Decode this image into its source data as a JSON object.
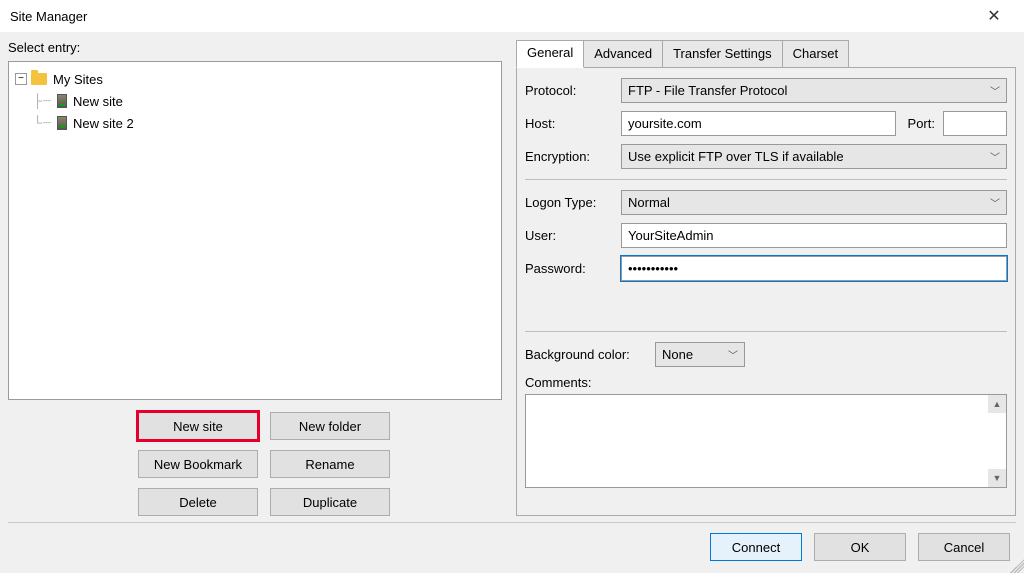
{
  "window": {
    "title": "Site Manager"
  },
  "left": {
    "select_label": "Select entry:",
    "tree": {
      "root": "My Sites",
      "children": [
        {
          "label": "New site"
        },
        {
          "label": "New site 2"
        }
      ]
    },
    "buttons": {
      "new_site": "New site",
      "new_folder": "New folder",
      "new_bookmark": "New Bookmark",
      "rename": "Rename",
      "delete": "Delete",
      "duplicate": "Duplicate"
    }
  },
  "tabs": {
    "general": "General",
    "advanced": "Advanced",
    "transfer": "Transfer Settings",
    "charset": "Charset"
  },
  "form": {
    "protocol_label": "Protocol:",
    "protocol_value": "FTP - File Transfer Protocol",
    "host_label": "Host:",
    "host_value": "yoursite.com",
    "port_label": "Port:",
    "port_value": "",
    "encryption_label": "Encryption:",
    "encryption_value": "Use explicit FTP over TLS if available",
    "logon_label": "Logon Type:",
    "logon_value": "Normal",
    "user_label": "User:",
    "user_value": "YourSiteAdmin",
    "password_label": "Password:",
    "password_value": "•••••••••••",
    "bgcolor_label": "Background color:",
    "bgcolor_value": "None",
    "comments_label": "Comments:",
    "comments_value": ""
  },
  "bottom": {
    "connect": "Connect",
    "ok": "OK",
    "cancel": "Cancel"
  }
}
